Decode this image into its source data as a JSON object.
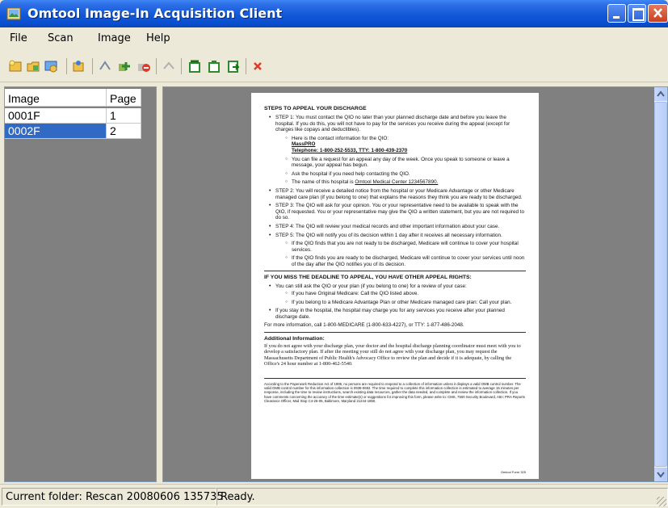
{
  "window": {
    "title": "Omtool Image-In Acquisition Client"
  },
  "menu": [
    "File",
    "Scan",
    "Image",
    "Help"
  ],
  "toolbar": {
    "icons": [
      "scan-new-icon",
      "scan-append-icon",
      "scan-settings-icon",
      "batch-icon",
      "rotate-icon",
      "add-page-icon",
      "remove-page-icon",
      "print-icon",
      "send-icon",
      "save-icon",
      "export-icon",
      "delete-icon"
    ]
  },
  "list": {
    "columns": [
      "Image",
      "Page"
    ],
    "rows": [
      {
        "image": "0001F",
        "page": "1"
      },
      {
        "image": "0002F",
        "page": "2"
      }
    ]
  },
  "document": {
    "heading": "STEPS TO APPEAL YOUR DISCHARGE",
    "step1": "STEP 1: You must contact the QIO no later than your planned discharge date and before you leave the hospital. If you do this, you will not have to pay for the services you receive during the appeal (except for charges like copays and deductibles).",
    "step1_sub1": "Here is the contact information for the QIO:",
    "step1_qio": "MassPRO",
    "step1_phone": "Telephone: 1-800-252-5533, TTY: 1-800-439-2370",
    "step1_sub2": "You can file a request for an appeal any day of the week. Once you speak to someone or leave a message, your appeal has begun.",
    "step1_sub3": "Ask the hospital if you need help contacting the QIO.",
    "step1_sub4_pre": "The name of this hospital is",
    "step1_sub4_name": "Omtool Medical Center   1234567890.",
    "step2": "STEP 2: You will receive a detailed notice from the hospital or your Medicare Advantage or other Medicare managed care plan (if you belong to one) that explains the reasons they think you are ready to be discharged.",
    "step3": "STEP 3: The QIO will ask for your opinion. You or your representative need to be available to speak with the QIO, if requested. You or your representative may give the QIO a written statement, but you are not required to do so.",
    "step4": "STEP 4: The QIO will review your medical records and other important information about your case.",
    "step5": "STEP 5: The QIO will notify you of its decision within 1 day after it receives all necessary information.",
    "step5_sub1": "If the QIO finds that you are not ready to be discharged, Medicare will continue to cover your hospital services.",
    "step5_sub2": "If the QIO finds you are ready to be discharged, Medicare will continue to cover your services until noon of the day after the QIO notifies you of its decision.",
    "miss_heading": "IF YOU MISS THE DEADLINE TO APPEAL, YOU HAVE OTHER APPEAL RIGHTS:",
    "miss1": "You can still ask the QIO or your plan (if you belong to one) for a review of your case:",
    "miss1_sub1": "If you have Original Medicare: Call the QIO listed above.",
    "miss1_sub2": "If you belong to a Medicare Advantage Plan or other Medicare managed care plan: Call your plan.",
    "miss2": "If you stay in the hospital, the hospital may charge you for any services you receive after your planned discharge date.",
    "more_info": "For more information, call 1-800-MEDICARE (1-800-633-4227), or TTY: 1-877-486-2048.",
    "additional_heading": "Additional Information:",
    "additional_text": "If you do not agree with your discharge plan, your doctor and the hospital discharge planning coordinator must meet with you to develop a satisfactory plan. If after the meeting your still do not agree with your discharge plan, you may request the Massachusetts Department of Public Health's Advocacy Office to review the plan and decide if it is adequate, by calling the Office's 24 hour number at 1-800-462-5540.",
    "footnote": "According to the Paperwork Reduction Act of 1995, no persons are required to respond to a collection of information unless it displays a valid OMB control number. The valid OMB control number for this information collection is 0938-0692. The time required to complete this information collection is estimated to average 15 minutes per response, including the time to review instructions, search existing data resources, gather the data needed, and complete and review the information collection. If you have comments concerning the accuracy of the time estimate(s) or suggestions for improving this form, please write to: CMS, 7500 Security Boulevard, Attn: PRA Reports Clearance Officer, Mail Stop C4-26-05, Baltimore, Maryland 21244-1850.",
    "form_no": "Omtool Form 325"
  },
  "status": {
    "folder": "Current folder: Rescan 20080606 135735",
    "state": "Ready."
  }
}
